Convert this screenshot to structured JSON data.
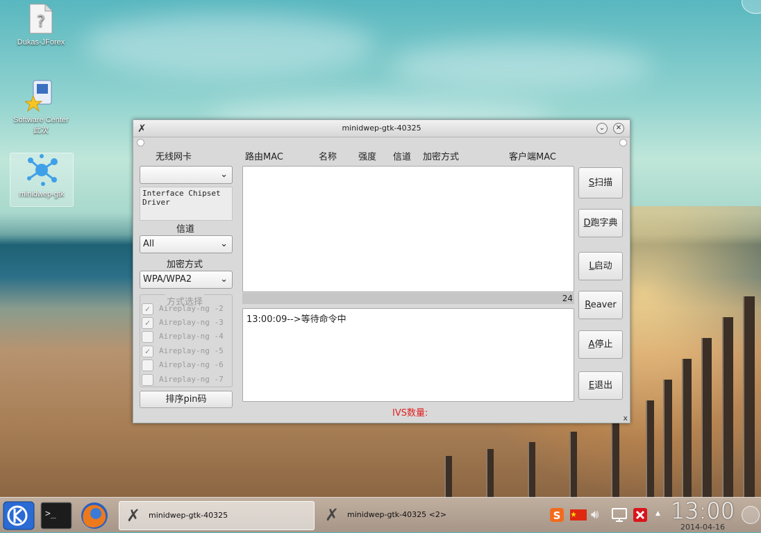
{
  "desktop": {
    "icons": [
      {
        "label": "Dukas-JForex"
      },
      {
        "label": "Software Center 此次"
      },
      {
        "label": "minidwep-gtk"
      }
    ]
  },
  "window": {
    "title": "minidwep-gtk-40325",
    "left": {
      "wireless_label": "无线网卡",
      "wireless_value": "",
      "info_text": "Interface Chipset Driver",
      "channel_label": "信道",
      "channel_value": "All",
      "enc_label": "加密方式",
      "enc_value": "WPA/WPA2",
      "mode_label": "方式选择",
      "checkboxes": [
        {
          "label": "Aireplay-ng -2",
          "checked": true
        },
        {
          "label": "Aireplay-ng -3",
          "checked": true
        },
        {
          "label": "Aireplay-ng -4",
          "checked": false
        },
        {
          "label": "Aireplay-ng -5",
          "checked": true
        },
        {
          "label": "Aireplay-ng -6",
          "checked": false
        },
        {
          "label": "Aireplay-ng -7",
          "checked": false
        }
      ],
      "pin_button": "排序pin码"
    },
    "columns": [
      "路由MAC",
      "名称",
      "强度",
      "信道",
      "加密方式",
      "客户端MAC"
    ],
    "progress_value": "24",
    "log_text": "13:00:09-->等待命令中",
    "ivs_label": "IVS数量:",
    "buttons": [
      {
        "key": "S",
        "text": "扫描"
      },
      {
        "key": "D",
        "text": "跑字典"
      },
      {
        "key": "L",
        "text": "启动"
      },
      {
        "key": "R",
        "text": "eaver"
      },
      {
        "key": "A",
        "text": "停止"
      },
      {
        "key": "E",
        "text": "退出"
      }
    ],
    "corner_close": "x"
  },
  "taskbar": {
    "tasks": [
      {
        "label": "minidwep-gtk-40325"
      },
      {
        "label": "minidwep-gtk-40325 <2>"
      }
    ],
    "clock_time": "13:00",
    "clock_date": "2014-04-16",
    "tray_caret": "▲"
  }
}
